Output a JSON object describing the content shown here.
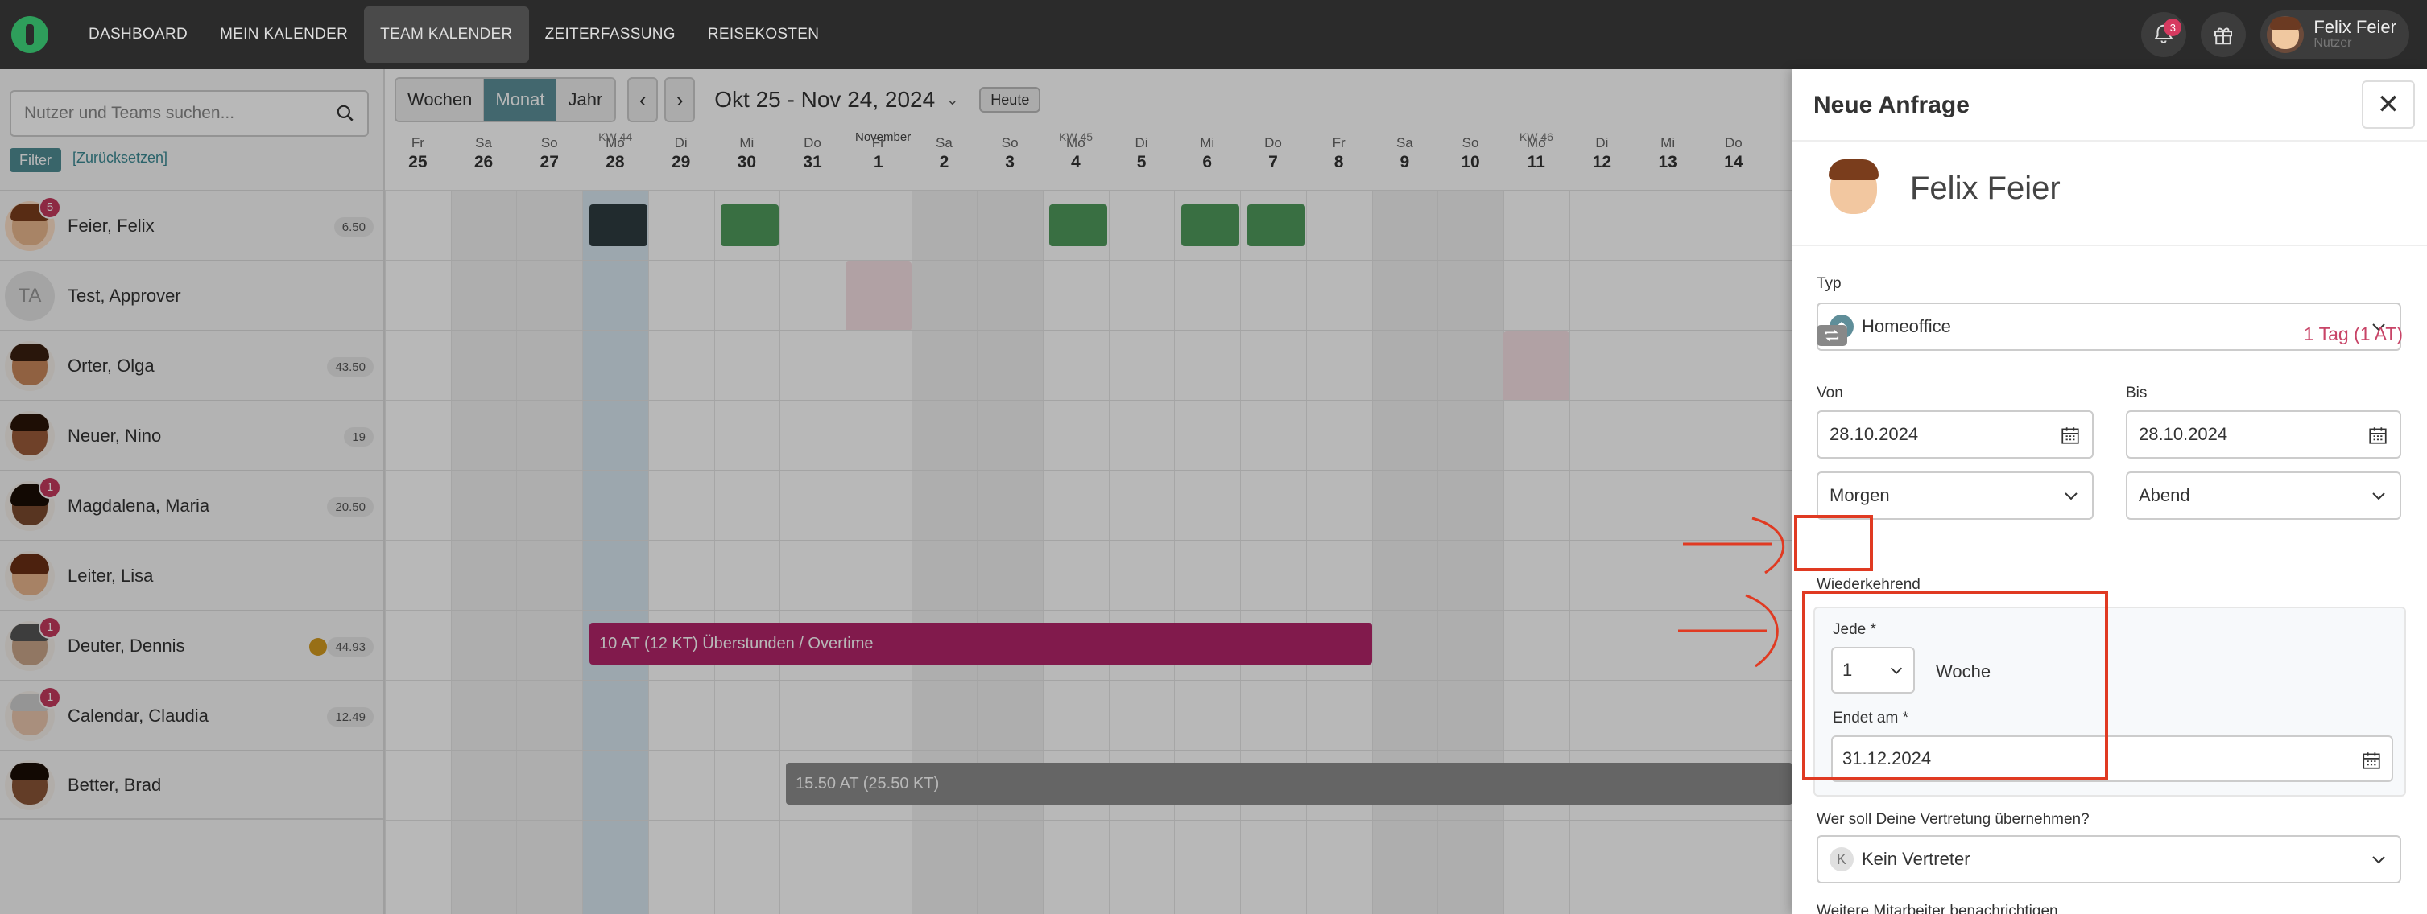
{
  "nav": {
    "items": [
      "DASHBOARD",
      "MEIN KALENDER",
      "TEAM KALENDER",
      "ZEITERFASSUNG",
      "REISEKOSTEN"
    ],
    "active": "TEAM KALENDER",
    "notifications": "3",
    "user_name": "Felix Feier",
    "user_role": "Nutzer"
  },
  "sidebar": {
    "search_placeholder": "Nutzer und Teams suchen...",
    "filter_label": "Filter",
    "reset_label": "[Zurücksetzen]",
    "users": [
      {
        "name": "Feier, Felix",
        "badge": "5",
        "hours": "6.50"
      },
      {
        "name": "Test, Approver",
        "initials": "TA"
      },
      {
        "name": "Orter, Olga",
        "hours": "43.50"
      },
      {
        "name": "Neuer, Nino",
        "hours": "19"
      },
      {
        "name": "Magdalena, Maria",
        "badge": "1",
        "hours": "20.50"
      },
      {
        "name": "Leiter, Lisa"
      },
      {
        "name": "Deuter, Dennis",
        "badge": "1",
        "hours": "44.93"
      },
      {
        "name": "Calendar, Claudia",
        "badge": "1",
        "hours": "12.49"
      },
      {
        "name": "Better, Brad"
      }
    ]
  },
  "calendar": {
    "views": [
      "Wochen",
      "Monat",
      "Jahr"
    ],
    "active_view": "Monat",
    "range_label": "Okt 25 - Nov 24, 2024",
    "today_label": "Heute",
    "month_label": "November",
    "weeks": [
      {
        "label": "KW 44",
        "day": 3
      },
      {
        "label": "KW 45",
        "day": 10
      },
      {
        "label": "KW 46",
        "day": 17
      }
    ],
    "days": [
      {
        "wd": "Fr",
        "d": "25"
      },
      {
        "wd": "Sa",
        "d": "26"
      },
      {
        "wd": "So",
        "d": "27"
      },
      {
        "wd": "Mo",
        "d": "28"
      },
      {
        "wd": "Di",
        "d": "29"
      },
      {
        "wd": "Mi",
        "d": "30"
      },
      {
        "wd": "Do",
        "d": "31"
      },
      {
        "wd": "Fr",
        "d": "1"
      },
      {
        "wd": "Sa",
        "d": "2"
      },
      {
        "wd": "So",
        "d": "3"
      },
      {
        "wd": "Mo",
        "d": "4"
      },
      {
        "wd": "Di",
        "d": "5"
      },
      {
        "wd": "Mi",
        "d": "6"
      },
      {
        "wd": "Do",
        "d": "7"
      },
      {
        "wd": "Fr",
        "d": "8"
      },
      {
        "wd": "Sa",
        "d": "9"
      },
      {
        "wd": "So",
        "d": "10"
      },
      {
        "wd": "Mo",
        "d": "11"
      },
      {
        "wd": "Di",
        "d": "12"
      },
      {
        "wd": "Mi",
        "d": "13"
      },
      {
        "wd": "Do",
        "d": "14"
      }
    ],
    "overtime_label": "10 AT (12 KT) Überstunden / Overtime",
    "gray_bar_label": "15.50 AT (25.50 KT)"
  },
  "panel": {
    "title": "Neue Anfrage",
    "user_name": "Felix Feier",
    "type_label": "Typ",
    "type_value": "Homeoffice",
    "from_label": "Von",
    "from_value": "28.10.2024",
    "to_label": "Bis",
    "to_value": "28.10.2024",
    "from_part": "Morgen",
    "to_part": "Abend",
    "day_count": "1 Tag (1 AT)",
    "recurring_label": "Wiederkehrend",
    "every_label": "Jede *",
    "every_value": "1",
    "every_unit": "Woche",
    "ends_label": "Endet am *",
    "ends_value": "31.12.2024",
    "substitute_label": "Wer soll Deine Vertretung übernehmen?",
    "substitute_value": "Kein Vertreter",
    "substitute_initial": "K",
    "notify_label": "Weitere Mitarbeiter benachrichtigen"
  }
}
